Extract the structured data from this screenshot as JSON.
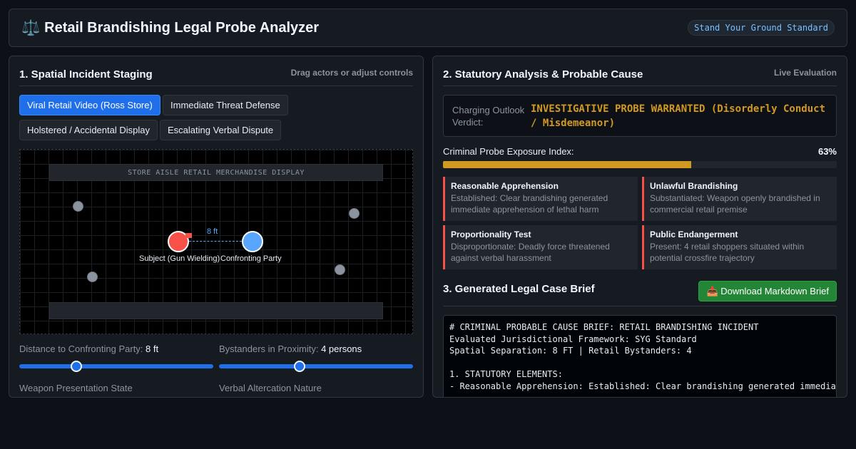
{
  "header": {
    "title": "Retail Brandishing Legal Probe Analyzer",
    "icon": "scales-icon",
    "standard_badge": "Stand Your Ground Standard"
  },
  "staging": {
    "title": "1. Spatial Incident Staging",
    "hint": "Drag actors or adjust controls",
    "presets": [
      {
        "label": "Viral Retail Video (Ross Store)",
        "active": true
      },
      {
        "label": "Immediate Threat Defense",
        "active": false
      },
      {
        "label": "Holstered / Accidental Display",
        "active": false
      },
      {
        "label": "Escalating Verbal Dispute",
        "active": false
      }
    ],
    "scene": {
      "shelf_label": "STORE AISLE RETAIL MERCHANDISE DISPLAY",
      "distance_label": "8 ft",
      "subject_label": "Subject (Gun Wielding)",
      "party_label": "Confronting Party"
    },
    "controls": {
      "distance_label": "Distance to Confronting Party:",
      "distance_value": "8 ft",
      "distance_fraction": 0.28,
      "bystanders_label": "Bystanders in Proximity:",
      "bystanders_value": "4 persons",
      "bystanders_fraction": 0.41,
      "weapon_label": "Weapon Presentation State",
      "verbal_label": "Verbal Altercation Nature"
    }
  },
  "analysis": {
    "title": "2. Statutory Analysis & Probable Cause",
    "hint": "Live Evaluation",
    "verdict_label": "Charging Outlook Verdict:",
    "verdict_value": "INVESTIGATIVE PROBE WARRANTED (Disorderly Conduct / Misdemeanor)",
    "exposure_label": "Criminal Probe Exposure Index:",
    "exposure_value": "63%",
    "exposure_percent": 63,
    "elements": [
      {
        "title": "Reasonable Apprehension",
        "desc": "Established: Clear brandishing generated immediate apprehension of lethal harm"
      },
      {
        "title": "Unlawful Brandishing",
        "desc": "Substantiated: Weapon openly brandished in commercial retail premise"
      },
      {
        "title": "Proportionality Test",
        "desc": "Disproportionate: Deadly force threatened against verbal harassment"
      },
      {
        "title": "Public Endangerment",
        "desc": "Present: 4 retail shoppers situated within potential crossfire trajectory"
      }
    ]
  },
  "brief": {
    "title": "3. Generated Legal Case Brief",
    "download_label": "Download Markdown Brief",
    "download_icon": "inbox-tray-icon",
    "lines": [
      "# CRIMINAL PROBABLE CAUSE BRIEF: RETAIL BRANDISHING INCIDENT",
      "Evaluated Jurisdictional Framework: SYG Standard",
      "Spatial Separation: 8 FT | Retail Bystanders: 4",
      "",
      "1. STATUTORY ELEMENTS:",
      "- Reasonable Apprehension: Established: Clear brandishing generated immediate apprehension of lethal harm"
    ]
  },
  "colors": {
    "background": "#0d1117",
    "accent": "#1f6feb",
    "verdict": "#d29922",
    "danger": "#f85149",
    "success": "#238636"
  }
}
